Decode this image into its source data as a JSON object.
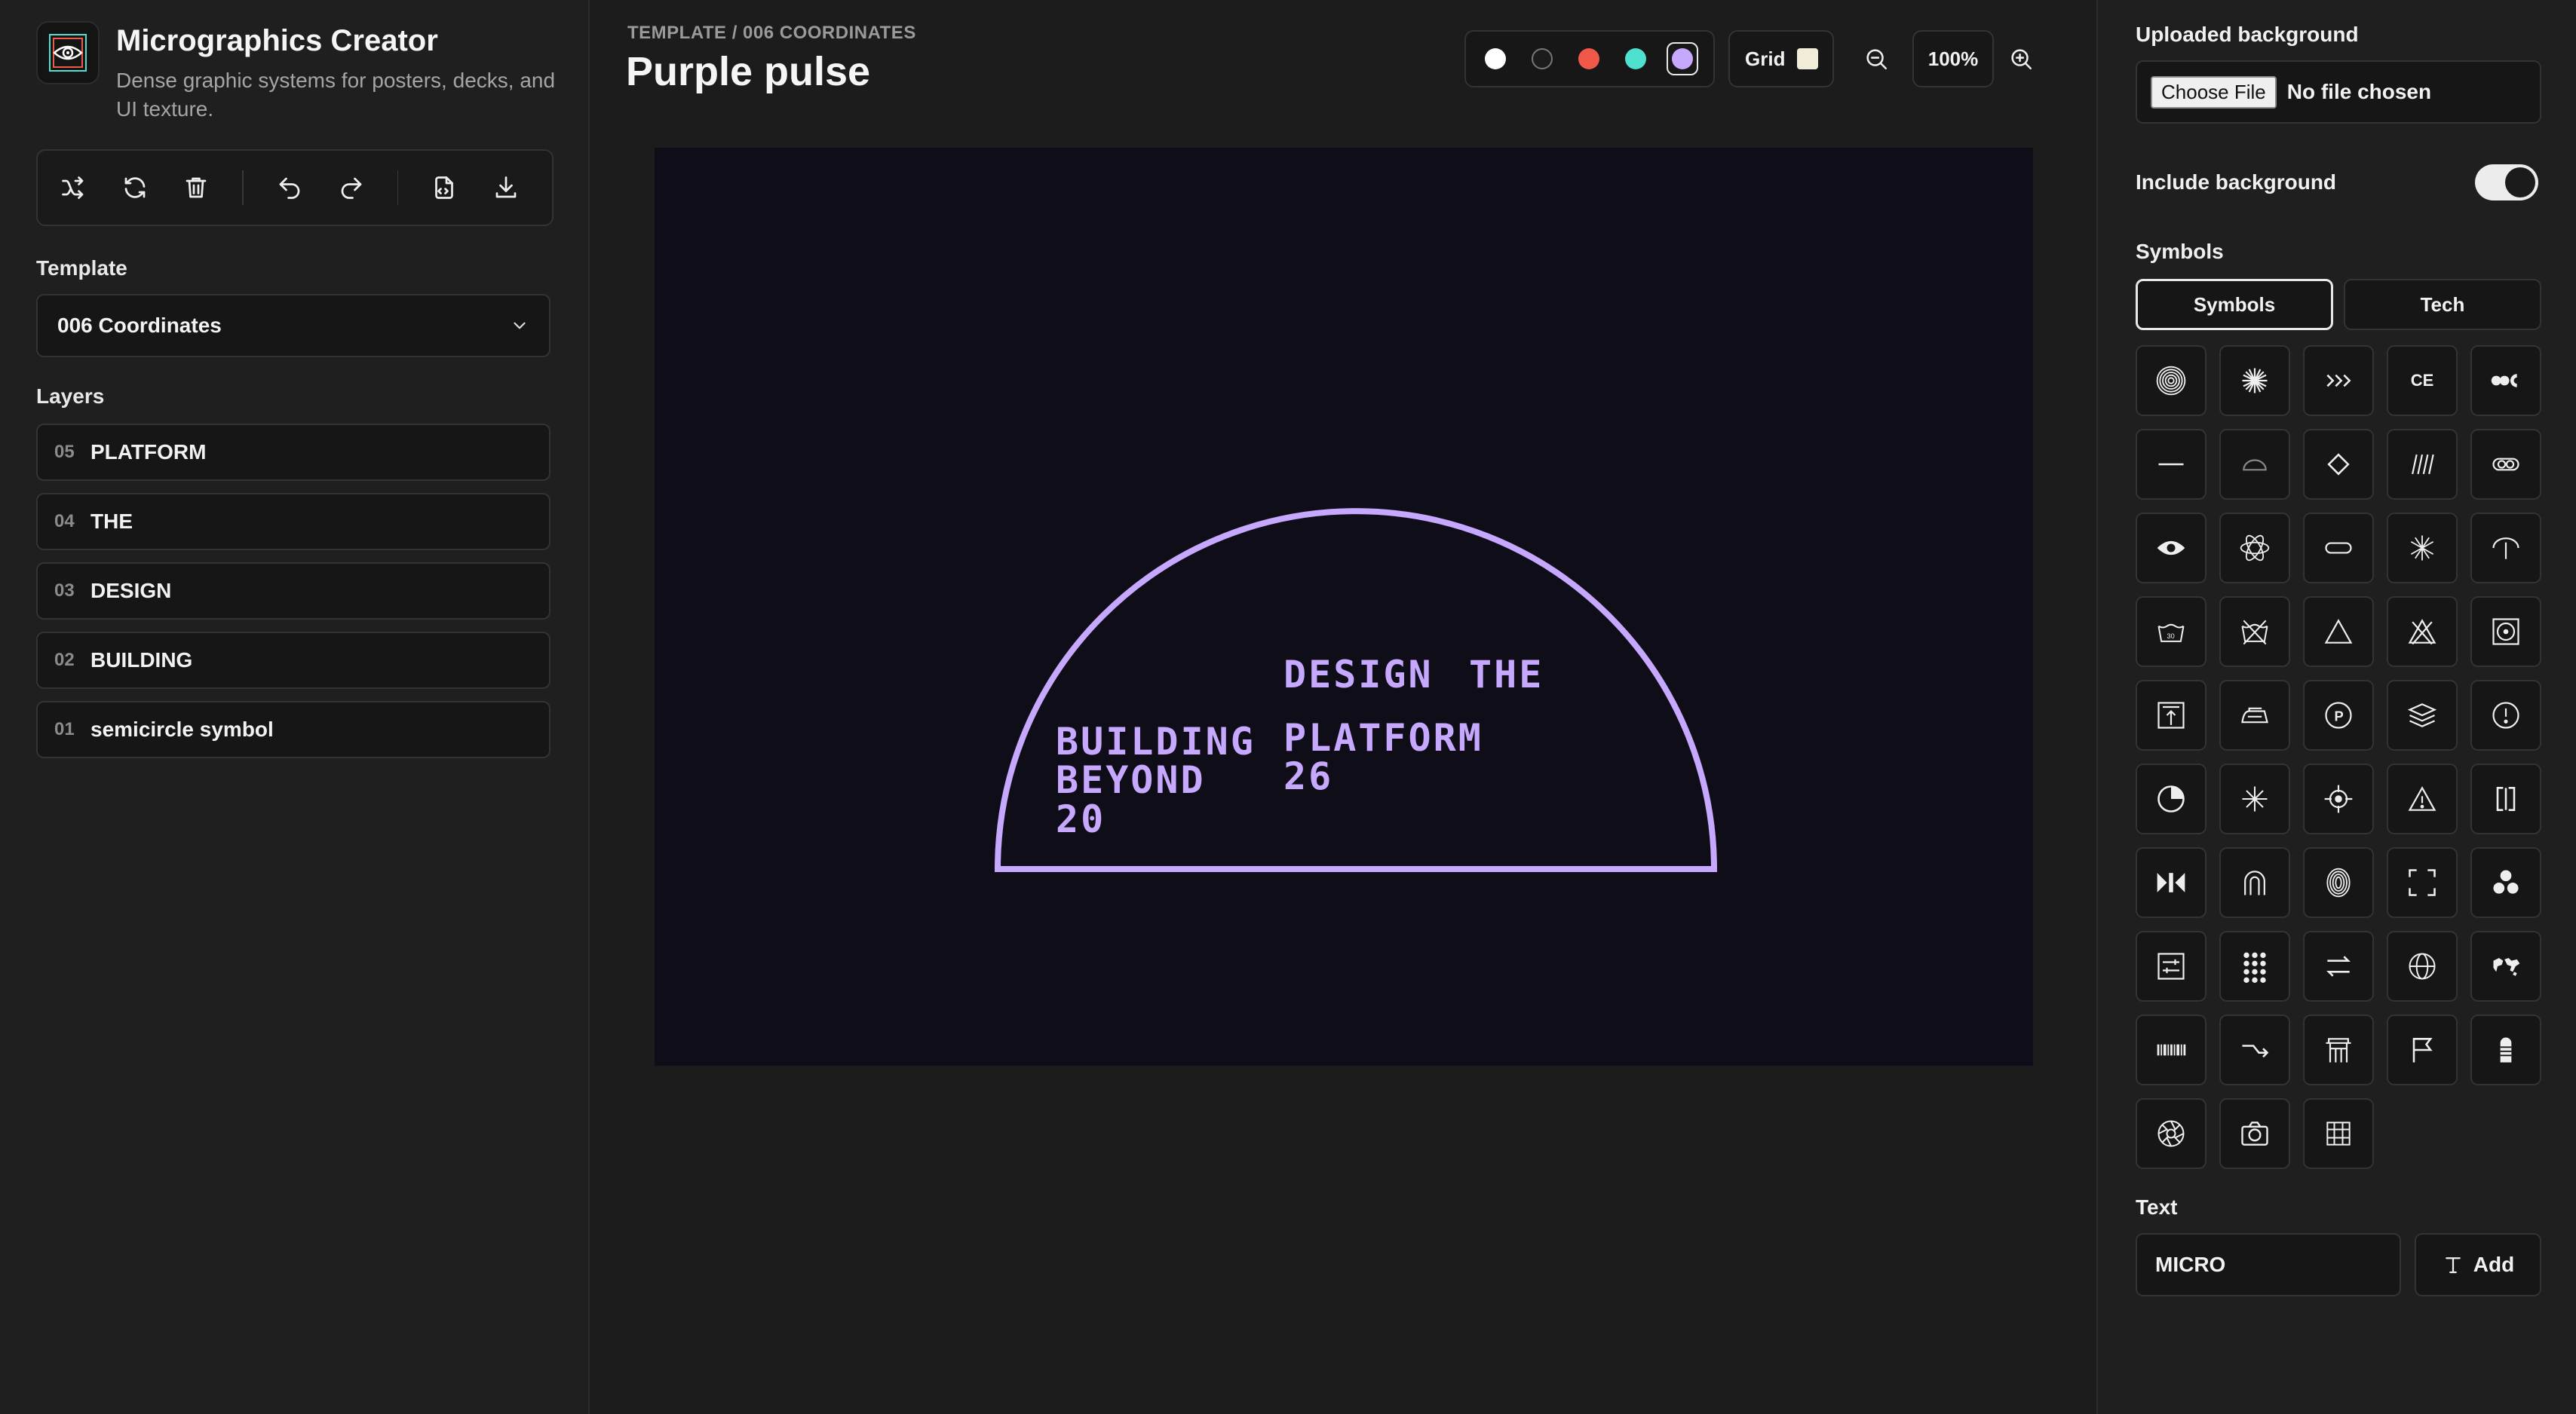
{
  "app": {
    "title": "Micrographics Creator",
    "subtitle": "Dense graphic systems for posters, decks, and UI texture."
  },
  "toolbar": {
    "icons": [
      "shuffle-icon",
      "refresh-icon",
      "trash-icon",
      "undo-icon",
      "redo-icon",
      "export-icon",
      "download-icon"
    ]
  },
  "template": {
    "label": "Template",
    "selected": "006 Coordinates"
  },
  "layers": {
    "label": "Layers",
    "items": [
      {
        "num": "05",
        "name": "PLATFORM"
      },
      {
        "num": "04",
        "name": "THE"
      },
      {
        "num": "03",
        "name": "DESIGN"
      },
      {
        "num": "02",
        "name": "BUILDING"
      },
      {
        "num": "01",
        "name": "semicircle symbol"
      }
    ]
  },
  "header": {
    "breadcrumb": "TEMPLATE / 006 COORDINATES",
    "title": "Purple pulse",
    "swatches": [
      {
        "color": "#ffffff",
        "active": false
      },
      {
        "color": "#1c1c1c",
        "active": false
      },
      {
        "color": "#f0584a",
        "active": false
      },
      {
        "color": "#4fe0cf",
        "active": false
      },
      {
        "color": "#c6a8ff",
        "active": true
      }
    ],
    "grid_label": "Grid",
    "zoom": "100%"
  },
  "canvas": {
    "background": "#0f0e18",
    "accent": "#c6a8ff",
    "texts": {
      "design": "DESIGN",
      "the": "THE",
      "building": "BUILDING",
      "beyond": "BEYOND",
      "twenty": "20",
      "platform": "PLATFORM",
      "twentysix": "26"
    }
  },
  "right": {
    "upload_label": "Uploaded background",
    "choose_file": "Choose File",
    "no_file": "No file chosen",
    "include_bg": "Include background",
    "include_bg_on": true,
    "symbols_label": "Symbols",
    "tabs": [
      "Symbols",
      "Tech"
    ],
    "symbols": [
      "spiral-icon",
      "starburst-icon",
      "chevrons-icon",
      "ce-mark-icon",
      "circles-icon",
      "line-icon",
      "dome-icon",
      "diamond-icon",
      "hatch-icon",
      "chain-icon",
      "eye-icon",
      "atom-icon",
      "pill-icon",
      "asterisk-icon",
      "umbrella-icon",
      "wash-icon",
      "no-wash-icon",
      "triangle-icon",
      "no-bleach-icon",
      "tumble-dry-icon",
      "upload-box-icon",
      "iron-icon",
      "parking-icon",
      "layers-icon",
      "info-icon",
      "pie-icon",
      "sparkle-icon",
      "crosshair-icon",
      "warning-icon",
      "brackets-icon",
      "bowtie-icon",
      "arch-icon",
      "fingerprint-icon",
      "frame-corners-icon",
      "radiation-icon",
      "sliders-icon",
      "dots-grid-icon",
      "swap-icon",
      "globe-icon",
      "world-map-icon",
      "barcode-icon",
      "hook-arrow-icon",
      "gate-icon",
      "flag-icon",
      "bullet-icon",
      "aperture-icon",
      "camera-icon",
      "table-grid-icon"
    ],
    "text_label": "Text",
    "text_value": "MICRO",
    "add_label": "Add"
  }
}
